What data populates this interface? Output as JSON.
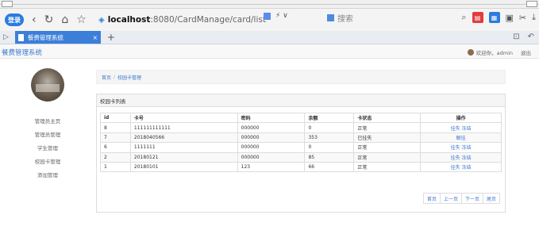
{
  "browser": {
    "login_badge": "登录",
    "url_host": "localhost",
    "url_path": ":8080/CardManage/card/list",
    "url_tools": "⚡ ∨",
    "search_placeholder": "搜索",
    "tab_title": "餐费管理系统",
    "tab_close": "×",
    "tab_plus": "+"
  },
  "app": {
    "title": "餐费管理系统",
    "welcome": "欢迎你，admin",
    "logout": "退出"
  },
  "sidebar": {
    "items": [
      {
        "label": "管理员主页"
      },
      {
        "label": "管理员管理"
      },
      {
        "label": "学生管理"
      },
      {
        "label": "校园卡管理"
      },
      {
        "label": "添加管理"
      }
    ]
  },
  "breadcrumb": {
    "home": "首页",
    "separator": "/",
    "current": "校园卡管理"
  },
  "panel": {
    "title": "校园卡列表"
  },
  "table": {
    "headers": [
      "id",
      "卡号",
      "密码",
      "余额",
      "卡状态",
      "操作"
    ],
    "rows": [
      {
        "id": "8",
        "card": "111111111111",
        "pwd": "000000",
        "balance": "0",
        "state": "正常",
        "ops": [
          "挂失",
          "冻结"
        ]
      },
      {
        "id": "7",
        "card": "2018040566",
        "pwd": "000000",
        "balance": "353",
        "state": "已挂失",
        "ops": [
          "解挂"
        ]
      },
      {
        "id": "6",
        "card": "1111111",
        "pwd": "000000",
        "balance": "0",
        "state": "正常",
        "ops": [
          "挂失",
          "冻结"
        ]
      },
      {
        "id": "2",
        "card": "20180121",
        "pwd": "000000",
        "balance": "85",
        "state": "正常",
        "ops": [
          "挂失",
          "冻结"
        ]
      },
      {
        "id": "1",
        "card": "20180101",
        "pwd": "123",
        "balance": "66",
        "state": "正常",
        "ops": [
          "挂失",
          "冻结"
        ]
      }
    ]
  },
  "pager": {
    "first": "首页",
    "prev": "上一页",
    "next": "下一页",
    "last": "尾页"
  },
  "colors": {
    "accent": "#3c78d0",
    "tab_active": "#3b7fd9"
  }
}
